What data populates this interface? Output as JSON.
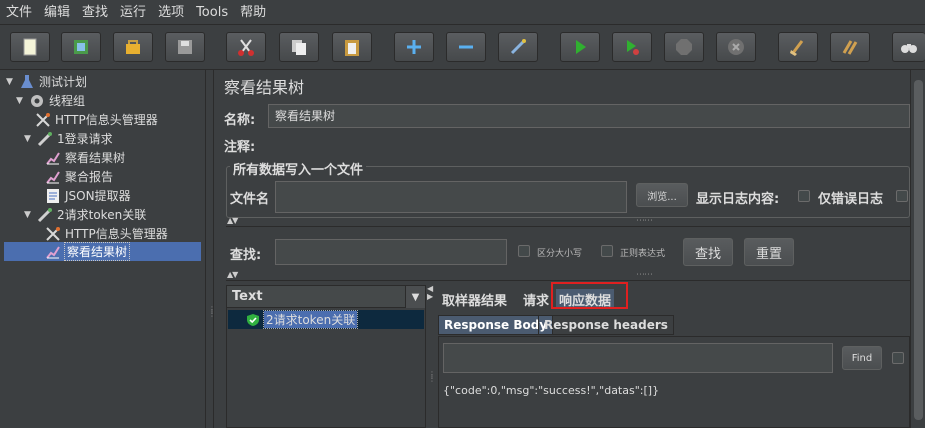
{
  "menu": [
    "文件",
    "编辑",
    "查找",
    "运行",
    "选项",
    "Tools",
    "帮助"
  ],
  "toolbar_icons": [
    "new-icon",
    "template-icon",
    "open-icon",
    "save-icon",
    "cut-icon",
    "copy-icon",
    "paste-icon",
    "expand-icon",
    "collapse-icon",
    "toggle-icon",
    "start-icon",
    "start-no-pause-icon",
    "stop-icon",
    "shutdown-icon",
    "clear-icon",
    "clear-all-icon",
    "search-binoculars-icon"
  ],
  "tree": {
    "items": [
      {
        "label": "测试计划"
      },
      {
        "label": "线程组"
      },
      {
        "label": "HTTP信息头管理器"
      },
      {
        "label": "1登录请求"
      },
      {
        "label": "察看结果树"
      },
      {
        "label": "聚合报告"
      },
      {
        "label": "JSON提取器"
      },
      {
        "label": "2请求token关联"
      },
      {
        "label": "HTTP信息头管理器"
      },
      {
        "label": "察看结果树"
      }
    ]
  },
  "main": {
    "title": "察看结果树",
    "name_label": "名称:",
    "name_value": "察看结果树",
    "comment_label": "注释:",
    "comment_value": "",
    "group_title": "所有数据写入一个文件",
    "filename_label": "文件名",
    "filename_value": "",
    "browse_label": "浏览...",
    "log_content_label": "显示日志内容:",
    "errors_only_label": "仅错误日志",
    "search_label": "查找:",
    "search_value": "",
    "case_sensitive_label": "区分大小写",
    "regex_label": "正则表达式",
    "search_button": "查找",
    "reset_button": "重置"
  },
  "results": {
    "column_header": "Text",
    "rows": [
      "2请求token关联"
    ],
    "tabs": [
      "取样器结果",
      "请求",
      "响应数据"
    ],
    "active_tab": "响应数据",
    "subtabs": [
      "Response Body",
      "Response headers"
    ],
    "find_button": "Find",
    "find_value": "",
    "body_text": "{\"code\":0,\"msg\":\"success!\",\"datas\":[]}"
  },
  "colors": {
    "accent": "#4b6eaf",
    "highlight": "#e02020",
    "background": "#3c3f41"
  }
}
